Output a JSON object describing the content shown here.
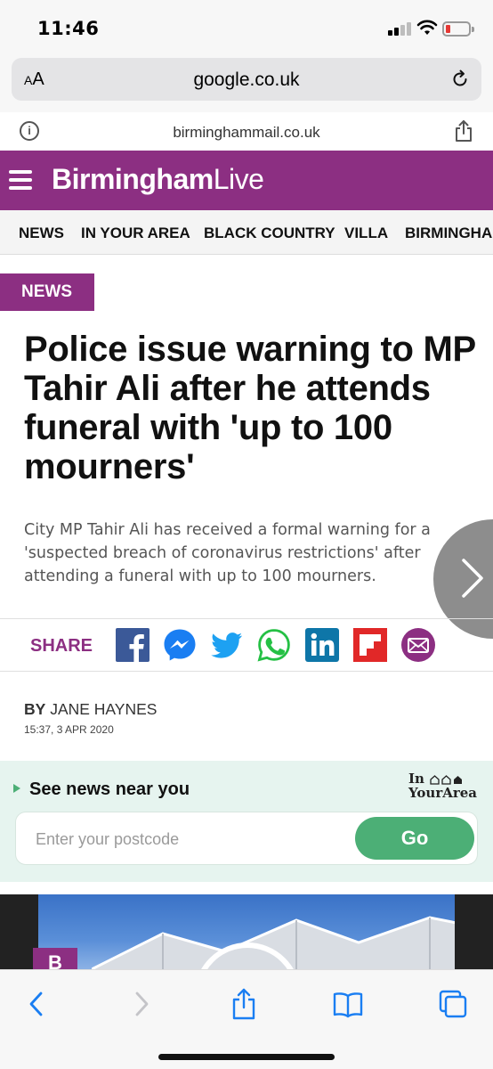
{
  "status_bar": {
    "time": "11:46"
  },
  "browser": {
    "text_size_label": "AA",
    "url": "google.co.uk",
    "site_domain": "birminghammail.co.uk"
  },
  "brand": {
    "logo_bold": "Birmingham",
    "logo_light": "Live",
    "color": "#8c2f82"
  },
  "nav": {
    "items": [
      "NEWS",
      "IN YOUR AREA",
      "BLACK COUNTRY",
      "VILLA",
      "BIRMINGHAM"
    ]
  },
  "article": {
    "tag": "NEWS",
    "headline": "Police issue warning to MP Tahir Ali after he attends funeral with 'up to 100 mourners'",
    "standfirst": "City MP Tahir Ali has received a formal warning for  a 'suspected breach of coronavirus restrictions' after attending a funeral with up to 100 mourners.",
    "byline_prefix": "BY",
    "author": "JANE HAYNES",
    "date": "15:37, 3 APR 2020"
  },
  "share": {
    "label": "SHARE",
    "icons": [
      "facebook-icon",
      "messenger-icon",
      "twitter-icon",
      "whatsapp-icon",
      "linkedin-icon",
      "flipboard-icon",
      "email-icon"
    ]
  },
  "in_your_area": {
    "title": "See news near you",
    "brand_line1": "In",
    "brand_line2": "YourArea",
    "placeholder": "Enter your postcode",
    "button": "Go",
    "accent": "#4caf76"
  },
  "image_badge": "B",
  "toolbar": {
    "icons": [
      "back-icon",
      "forward-icon",
      "share-icon",
      "bookmarks-icon",
      "tabs-icon"
    ]
  }
}
